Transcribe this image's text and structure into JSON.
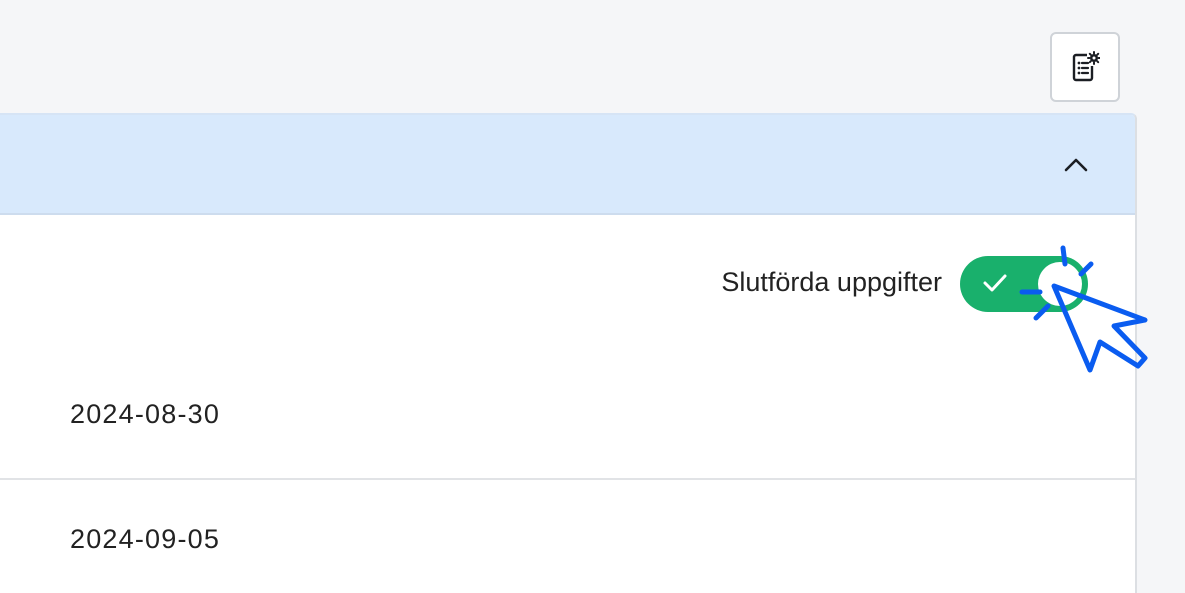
{
  "toolbar": {
    "settings_icon": "report-settings-icon"
  },
  "panel": {
    "collapse_icon": "chevron-up-icon",
    "completed_tasks_label": "Slutförda uppgifter",
    "completed_tasks_toggle_on": true,
    "rows": [
      {
        "date": "2024-08-30"
      },
      {
        "date": "2024-09-05"
      }
    ]
  },
  "colors": {
    "background": "#f5f6f8",
    "header": "#d8e9fc",
    "toggle_on": "#19b06c",
    "cursor": "#0a5cf0"
  }
}
